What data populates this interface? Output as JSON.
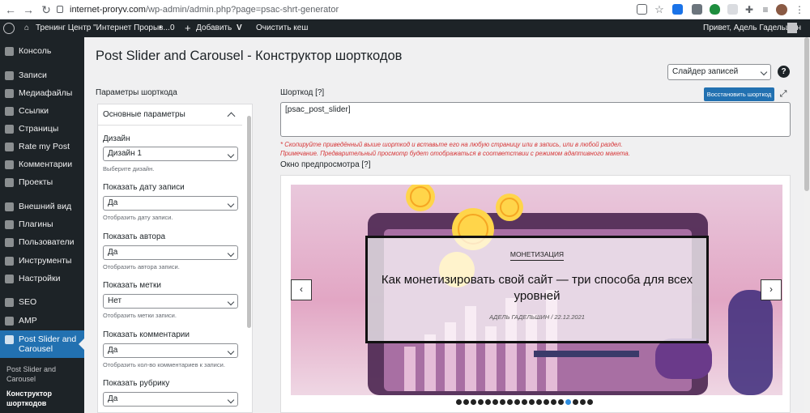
{
  "browser": {
    "url_host": "internet-proryv.com",
    "url_path": "/wp-admin/admin.php?page=psac-shrt-generator"
  },
  "adminbar": {
    "site_name": "Тренинг Центр \"Интернет Прорыв...",
    "comments_count": "0",
    "add_label": "Добавить",
    "clear_cache": "Очистить кеш",
    "greeting": "Привет, Адель Гадельшин"
  },
  "sidebar": {
    "items": [
      {
        "label": "Консоль"
      },
      {
        "label": "Записи"
      },
      {
        "label": "Медиафайлы"
      },
      {
        "label": "Ссылки"
      },
      {
        "label": "Страницы"
      },
      {
        "label": "Rate my Post"
      },
      {
        "label": "Комментарии"
      },
      {
        "label": "Проекты"
      },
      {
        "label": "Внешний вид"
      },
      {
        "label": "Плагины"
      },
      {
        "label": "Пользователи"
      },
      {
        "label": "Инструменты"
      },
      {
        "label": "Настройки"
      },
      {
        "label": "SEO"
      },
      {
        "label": "AMP"
      }
    ],
    "active_line1": "Post Slider and",
    "active_line2": "Carousel",
    "sub1_line1": "Post Slider and",
    "sub1_line2": "Carousel",
    "sub2_line1": "Конструктор",
    "sub2_line2": "шорткодов"
  },
  "page": {
    "title": "Post Slider and Carousel - Конструктор шорткодов",
    "type_select": "Слайдер записей",
    "help": "?"
  },
  "params": {
    "label": "Параметры шорткода",
    "header": "Основные параметры",
    "fields": [
      {
        "label": "Дизайн",
        "value": "Дизайн 1",
        "hint": "Выберите дизайн."
      },
      {
        "label": "Показать дату записи",
        "value": "Да",
        "hint": "Отобразить дату записи."
      },
      {
        "label": "Показать автора",
        "value": "Да",
        "hint": "Отобразить автора записи."
      },
      {
        "label": "Показать метки",
        "value": "Нет",
        "hint": "Отобразить метки записи."
      },
      {
        "label": "Показать комментарии",
        "value": "Да",
        "hint": "Отобразить кол-во комментариев к записи."
      },
      {
        "label": "Показать рубрику",
        "value": "Да",
        "hint": ""
      }
    ]
  },
  "shortcode": {
    "label": "Шорткод [?]",
    "restore": "Восстановить шорткод",
    "value": "[psac_post_slider]",
    "note1": "* Скопируйте приведённый выше шорткод и вставьте его на любую страницу или в запись, или в любой раздел.",
    "note2": "Примечание. Предварительный просмотр будет отображаться в соответствии с режимом адаптивного макета."
  },
  "preview": {
    "label": "Окно предпросмотра [?]",
    "category": "МОНЕТИЗАЦИЯ",
    "post_title": "Как монетизировать свой сайт — три способа для всех уровней",
    "meta": "АДЕЛЬ ГАДЕЛЬШИН  /  22.12.2021",
    "prev": "‹",
    "next": "›",
    "dots_total": 19,
    "dot_active": 16
  }
}
